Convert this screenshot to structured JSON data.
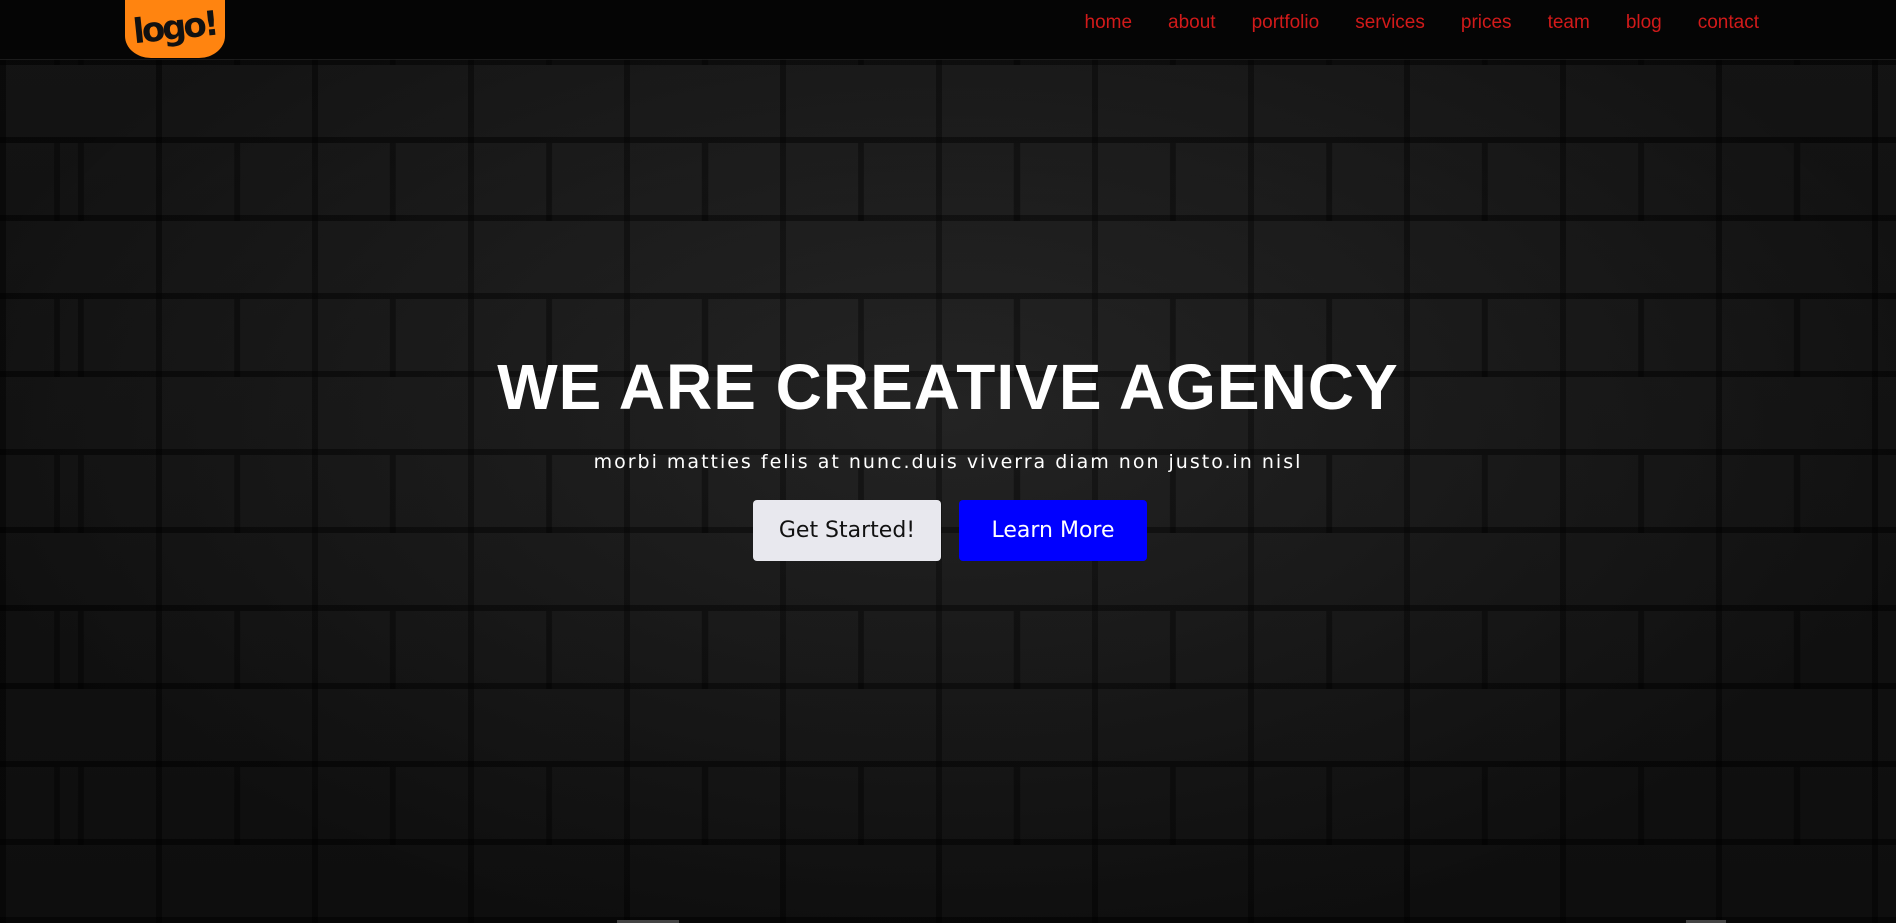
{
  "navbar": {
    "logo_text": "logo!",
    "links": [
      "home",
      "about",
      "portfolio",
      "services",
      "prices",
      "team",
      "blog",
      "contact"
    ]
  },
  "hero": {
    "title": "WE ARE CREATIVE AGENCY",
    "subtitle": "morbi matties felis at nunc.duis viverra diam non justo.in nisl",
    "primary_button": "Get Started!",
    "secondary_button": "Learn More"
  },
  "colors": {
    "logo_background": "#ff8410",
    "nav_link": "#d21a1a",
    "primary_button_bg": "#e8e8ee",
    "secondary_button_bg": "#0000ff",
    "navbar_bg": "#050505"
  }
}
